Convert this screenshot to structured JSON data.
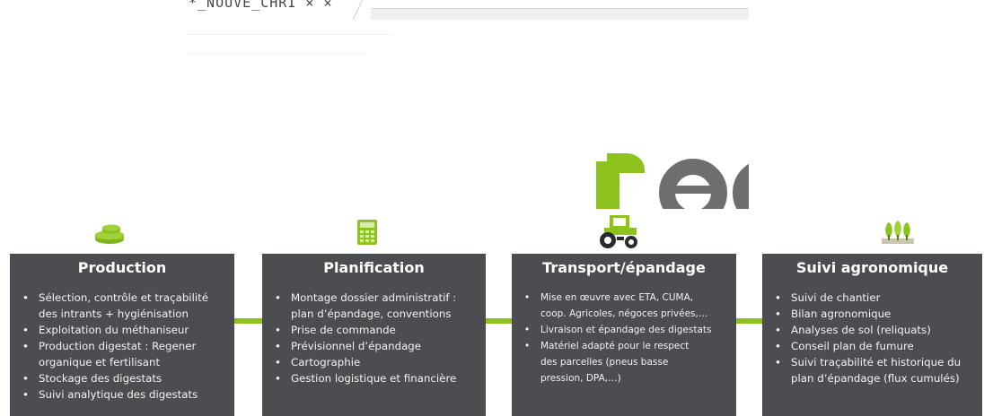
{
  "browser": {
    "tab_label": "*_NOUVE_CHRI × ×"
  },
  "logo": {
    "text": "rec",
    "green": "#8dc21f",
    "grey": "#6e6e6e"
  },
  "colors": {
    "card_bg": "#4b4d50",
    "connector": "#8dc21f"
  },
  "cards": [
    {
      "icon": "coins-icon",
      "title": "Production",
      "items": [
        "Sélection, contrôle et traçabilité",
        "des intrants + hygiénisation",
        "Exploitation du méthaniseur",
        "Production digestat : Regener",
        "organique et fertilisant",
        "Stockage des digestats",
        "Suivi analytique des digestats"
      ]
    },
    {
      "icon": "calculator-icon",
      "title": "Planification",
      "items": [
        "Montage dossier administratif :",
        "plan d’épandage, conventions",
        "Prise de commande",
        "Prévisionnel d’épandage",
        "Cartographie",
        "Gestion logistique et financière"
      ]
    },
    {
      "icon": "tractor-icon",
      "title": "Transport/épandage",
      "items": [
        "Mise en œuvre avec ETA, CUMA,",
        "coop. Agricoles, négoces privées,…",
        "Livraison et épandage des digestats",
        "Matériel adapté pour le respect",
        "des parcelles (pneus basse",
        "pression, DPA,…)"
      ]
    },
    {
      "icon": "plants-icon",
      "title": "Suivi agronomique",
      "items": [
        "Suivi de chantier",
        "Bilan agronomique",
        "Analyses de sol (reliquats)",
        "Conseil plan de fumure",
        "Suivi traçabilité et historique du",
        "plan d’épandage (flux cumulés)"
      ]
    }
  ]
}
